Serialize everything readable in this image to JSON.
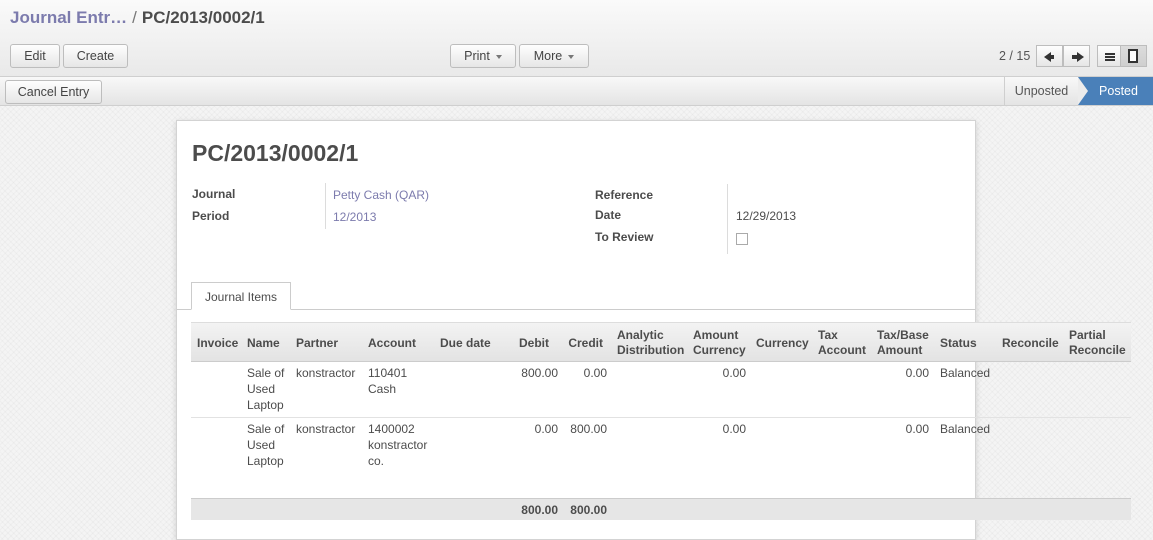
{
  "breadcrumb": {
    "parent": "Journal Entr…",
    "separator": "/",
    "current": "PC/2013/0002/1"
  },
  "toolbar": {
    "edit": "Edit",
    "create": "Create",
    "print": "Print",
    "more": "More"
  },
  "pager": {
    "text": "2 / 15"
  },
  "actions": {
    "cancel_entry": "Cancel Entry"
  },
  "statusbar": {
    "unposted": "Unposted",
    "posted": "Posted",
    "active": "Posted",
    "active_color": "#4a80b9"
  },
  "form": {
    "title": "PC/2013/0002/1",
    "journal_label": "Journal",
    "journal_value": "Petty Cash (QAR)",
    "period_label": "Period",
    "period_value": "12/2013",
    "reference_label": "Reference",
    "reference_value": "",
    "date_label": "Date",
    "date_value": "12/29/2013",
    "to_review_label": "To Review",
    "to_review_checked": false
  },
  "tabs": {
    "journal_items": "Journal Items"
  },
  "table": {
    "headers": {
      "invoice": "Invoice",
      "name": "Name",
      "partner": "Partner",
      "account": "Account",
      "due_date": "Due date",
      "debit": "Debit",
      "credit": "Credit",
      "analytic_1": "Analytic",
      "analytic_2": "Distribution",
      "amount_currency_1": "Amount",
      "amount_currency_2": "Currency",
      "currency": "Currency",
      "tax_account_1": "Tax",
      "tax_account_2": "Account",
      "tax_base_1": "Tax/Base",
      "tax_base_2": "Amount",
      "status": "Status",
      "reconcile": "Reconcile",
      "partial_1": "Partial",
      "partial_2": "Reconcile"
    },
    "rows": [
      {
        "name": [
          "Sale of",
          "Used",
          "Laptop"
        ],
        "partner": "konstractor",
        "account": [
          "110401",
          "Cash"
        ],
        "debit": "800.00",
        "credit": "0.00",
        "amount_currency": "0.00",
        "tax_amount": "0.00",
        "status": "Balanced"
      },
      {
        "name": [
          "Sale of",
          "Used",
          "Laptop"
        ],
        "partner": "konstractor",
        "account": [
          "1400002",
          "konstractor",
          "co."
        ],
        "debit": "0.00",
        "credit": "800.00",
        "amount_currency": "0.00",
        "tax_amount": "0.00",
        "status": "Balanced"
      }
    ],
    "totals": {
      "debit": "800.00",
      "credit": "800.00"
    }
  }
}
